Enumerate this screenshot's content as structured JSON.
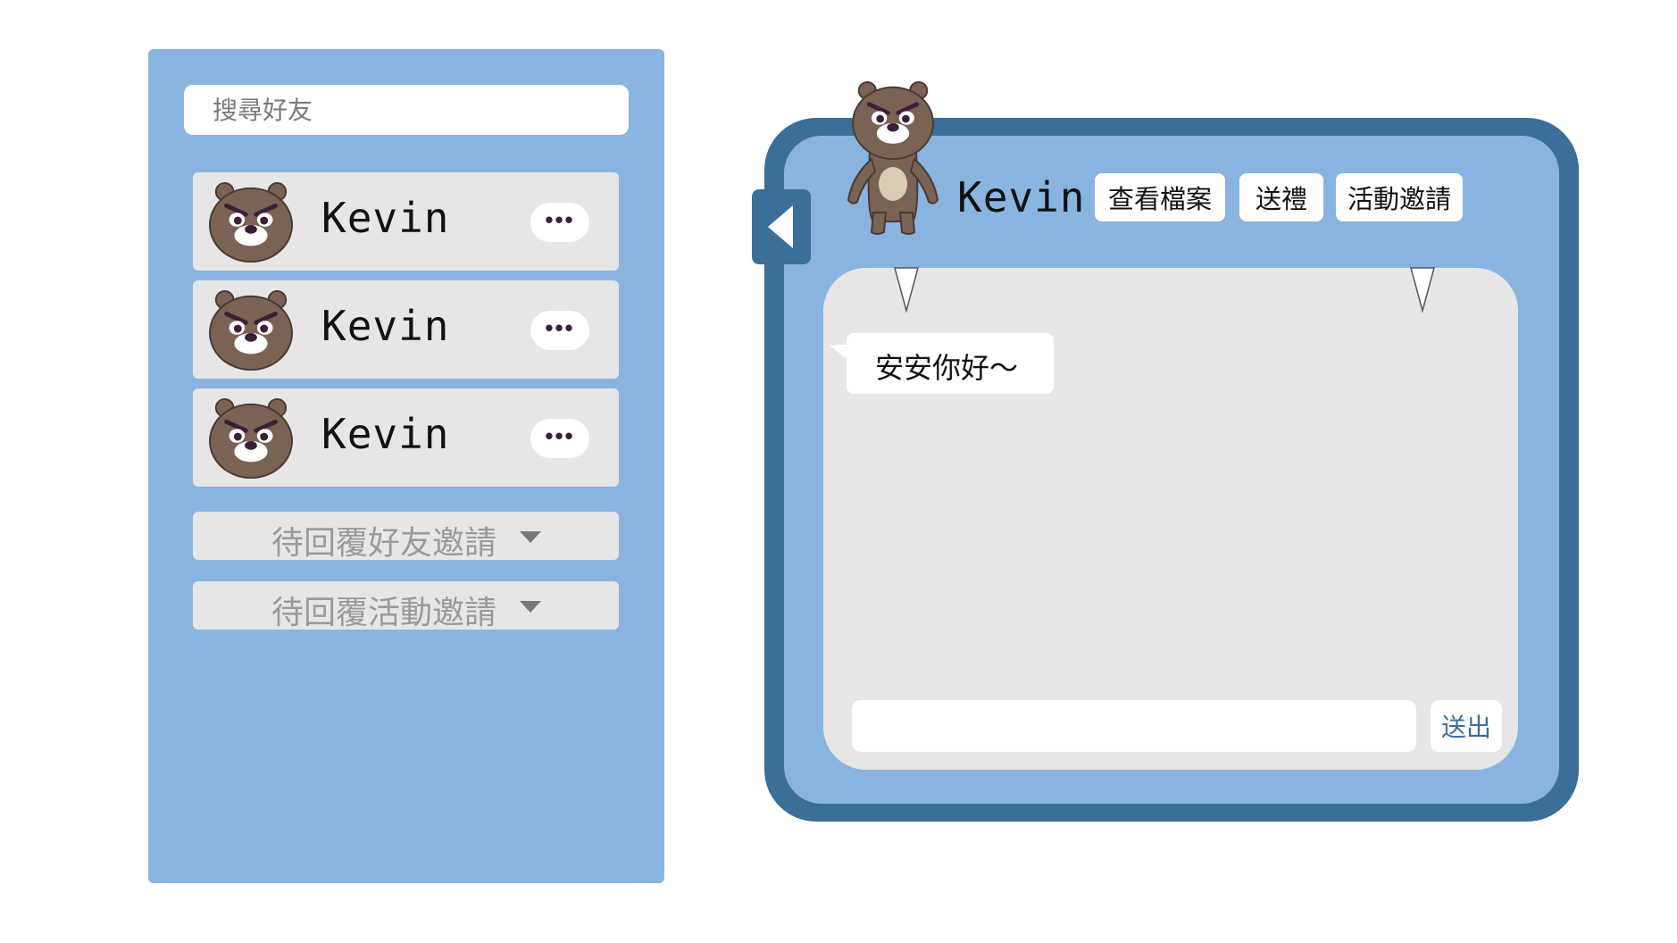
{
  "search": {
    "placeholder": "搜尋好友"
  },
  "friends": [
    {
      "name": "Kevin",
      "avatar_icon": "bear-avatar-icon",
      "more_label": "•••"
    },
    {
      "name": "Kevin",
      "avatar_icon": "bear-avatar-icon",
      "more_label": "•••"
    },
    {
      "name": "Kevin",
      "avatar_icon": "bear-avatar-icon",
      "more_label": "•••"
    }
  ],
  "invites": {
    "friend_requests_label": "待回覆好友邀請",
    "event_invites_label": "待回覆活動邀請"
  },
  "chat": {
    "contact_name": "Kevin",
    "buttons": {
      "view_profile": "查看檔案",
      "send_gift": "送禮",
      "event_invite": "活動邀請"
    },
    "messages": [
      {
        "text": "安安你好～"
      }
    ],
    "input_placeholder": "",
    "send_label": "送出",
    "back_icon": "back-arrow-icon"
  },
  "colors": {
    "panel_blue": "#89b4e0",
    "frame_blue": "#3b6e99",
    "row_gray": "#e6e6e6",
    "bear_brown": "#7a6255",
    "bear_eye": "#3a1f38"
  }
}
